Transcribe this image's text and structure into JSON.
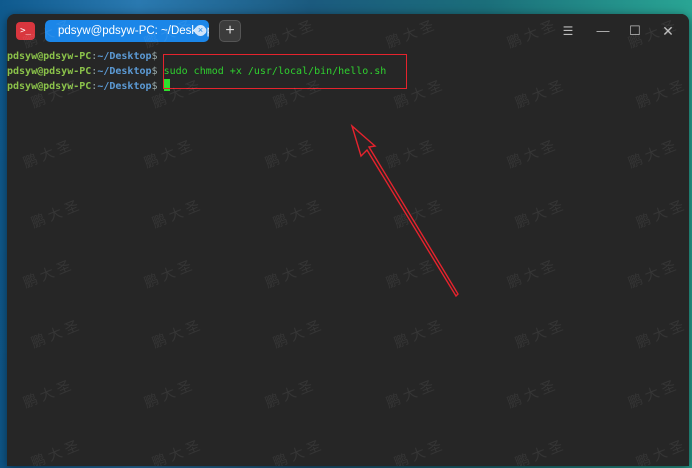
{
  "window": {
    "tab_title": "pdsyw@pdsyw-PC: ~/Desktop",
    "tab_close_glyph": "×",
    "new_tab_glyph": "+",
    "menu_glyph": "☰",
    "minimize_glyph": "—",
    "maximize_glyph": "☐",
    "close_glyph": "✕",
    "app_icon_glyph": ">_"
  },
  "terminal": {
    "lines": [
      {
        "user": "pdsyw@pdsyw-PC",
        "sep": ":",
        "path": "~/Desktop",
        "dollar": "$",
        "command": ""
      },
      {
        "user": "pdsyw@pdsyw-PC",
        "sep": ":",
        "path": "~/Desktop",
        "dollar": "$",
        "command": " sudo chmod +x /usr/local/bin/hello.sh"
      },
      {
        "user": "pdsyw@pdsyw-PC",
        "sep": ":",
        "path": "~/Desktop",
        "dollar": "$",
        "command": " "
      }
    ]
  },
  "colors": {
    "accent_tab": "#1b86e8",
    "annotation_red": "#e5232d",
    "prompt_user": "#8bc34a",
    "prompt_path": "#5c9bd6",
    "command_green": "#2fd12f",
    "terminal_bg": "#262626"
  },
  "watermark": {
    "text": "鹏 大 圣"
  }
}
